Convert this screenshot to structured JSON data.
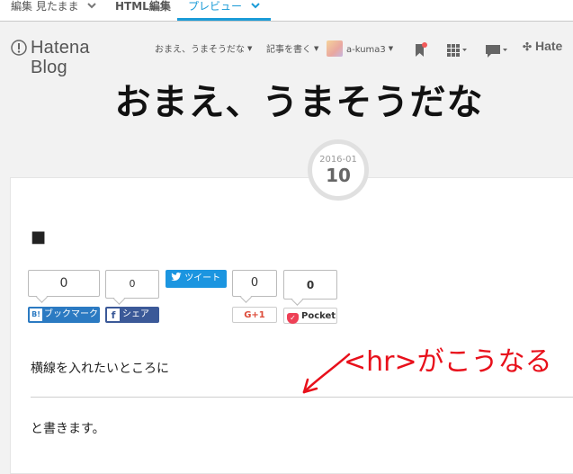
{
  "editor_tabs": {
    "edit_label": "編集",
    "edit_mode": "見たまま",
    "html_label": "HTML編集",
    "preview_label": "プレビュー"
  },
  "blog_header": {
    "logo_text": "Hatena Blog",
    "blog_menu": "おまえ、うまそうだな",
    "write_label": "記事を書く",
    "user_name": "a-kuma3",
    "hatena_right": "Hate"
  },
  "blog": {
    "title": "おまえ、うまそうだな"
  },
  "entry": {
    "date_ym": "2016-01",
    "date_day": "10",
    "title": "■",
    "paragraph1": "横線を入れたいところに",
    "paragraph2": "と書きます。"
  },
  "share": {
    "hatena_count": "0",
    "hatena_label": "ブックマーク",
    "hatena_icon_text": "B!",
    "facebook_count": "0",
    "facebook_label": "シェア",
    "twitter_label": "ツイート",
    "gplus_count": "0",
    "gplus_label": "G+1",
    "pocket_count": "0",
    "pocket_label": "Pocket"
  },
  "annotation": {
    "text": "<hr>がこうなる",
    "color": "#e8101b"
  },
  "colors": {
    "accent": "#1a9bd7",
    "hatena_blue": "#2b7ac2",
    "facebook_blue": "#3b5998",
    "twitter_blue": "#1b95e0",
    "gplus_red": "#dd4b39",
    "pocket_red": "#ee4056"
  }
}
